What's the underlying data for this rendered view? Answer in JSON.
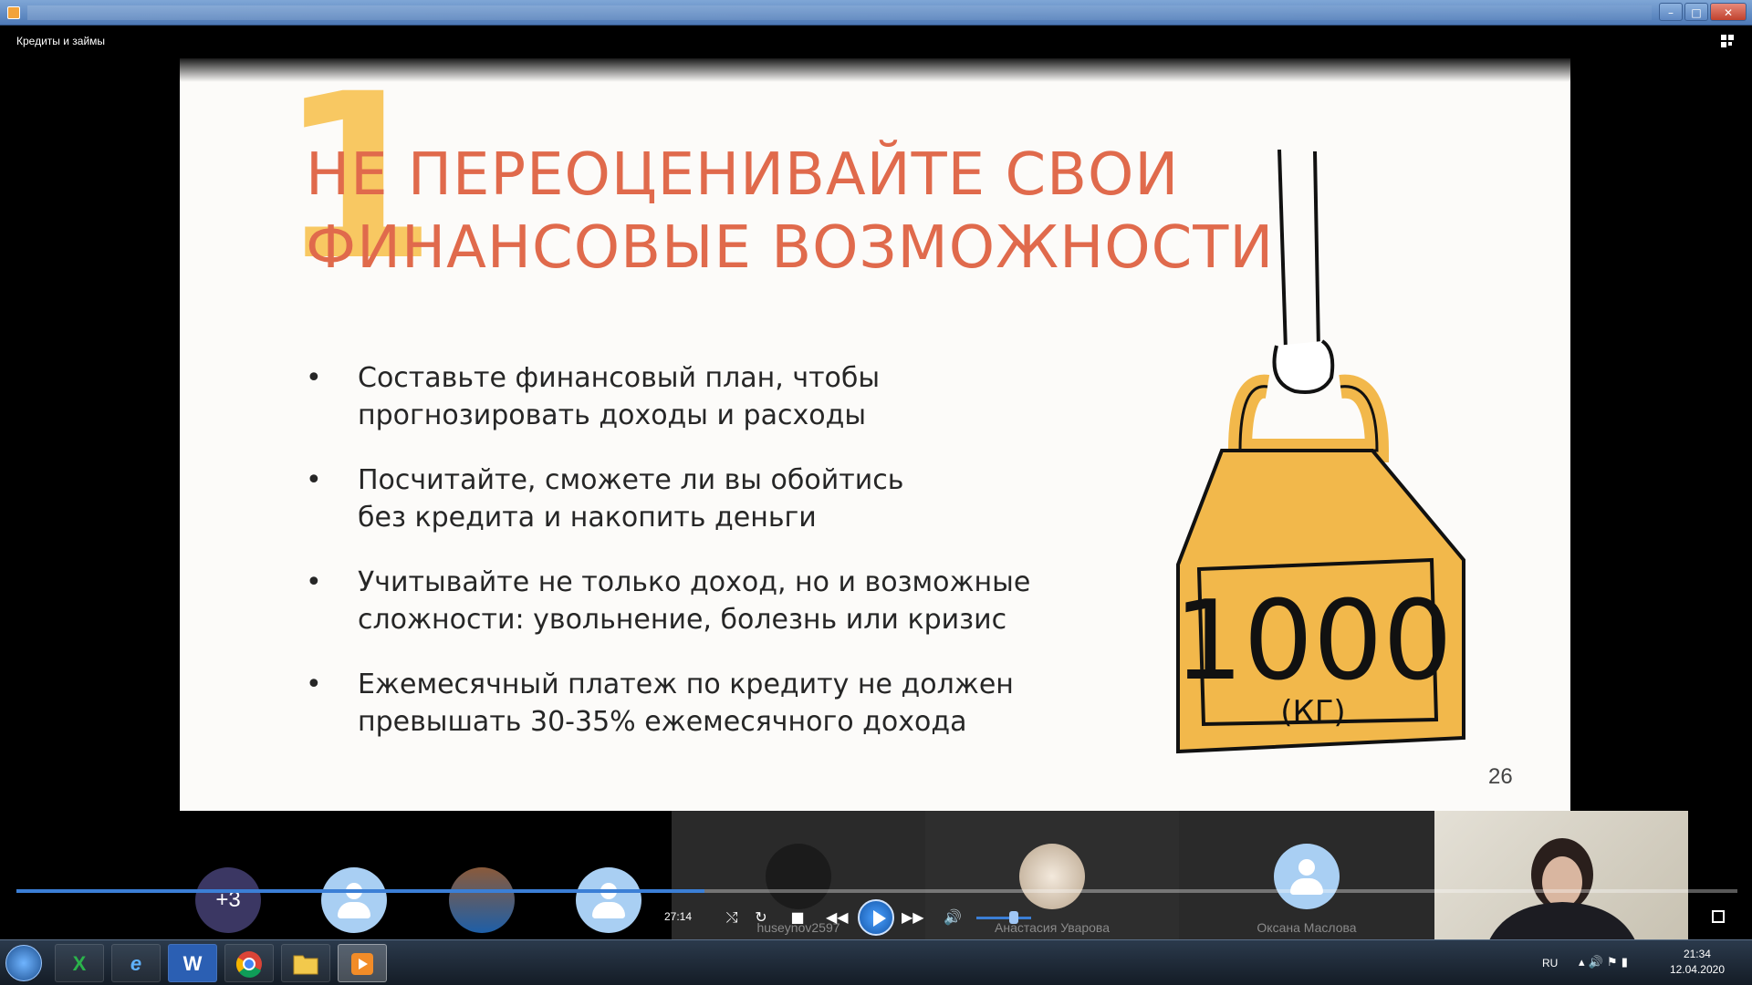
{
  "window": {
    "caption": "Кредиты и займы",
    "min_glyph": "–",
    "max_glyph": "□",
    "close_glyph": "✕"
  },
  "slide": {
    "number_mark": "1",
    "heading_line1": "НЕ ПЕРЕОЦЕНИВАЙТЕ СВОИ",
    "heading_line2": "ФИНАНСОВЫЕ ВОЗМОЖНОСТИ",
    "bullets": [
      {
        "line1": "Составьте финансовый план, чтобы",
        "line2": "прогнозировать доходы и расходы"
      },
      {
        "line1": "Посчитайте, сможете ли вы обойтись",
        "line2": "без кредита и накопить деньги"
      },
      {
        "line1": "Учитывайте не только доход, но и возможные",
        "line2": "сложности: увольнение, болезнь или кризис"
      },
      {
        "line1": "Ежемесячный платеж по кредиту не должен",
        "line2": "превышать 30-35% ежемесячного дохода"
      }
    ],
    "bullet_glyph": "•",
    "weight_value": "1000",
    "weight_unit": "(КГ)",
    "page_number": "26",
    "accent_color": "#e06a4c",
    "weight_color": "#f2b84b"
  },
  "participants": {
    "more_count": "+3",
    "names": {
      "tile5": "huseynov2597",
      "tile6": "Анастасия Уварова",
      "tile7": "Оксана Маслова"
    }
  },
  "player": {
    "time": "27:14",
    "progress": 0.4
  },
  "taskbar": {
    "excel_glyph": "X",
    "ie_glyph": "e",
    "word_glyph": "W",
    "lang": "RU",
    "time": "21:34",
    "date": "12.04.2020"
  }
}
